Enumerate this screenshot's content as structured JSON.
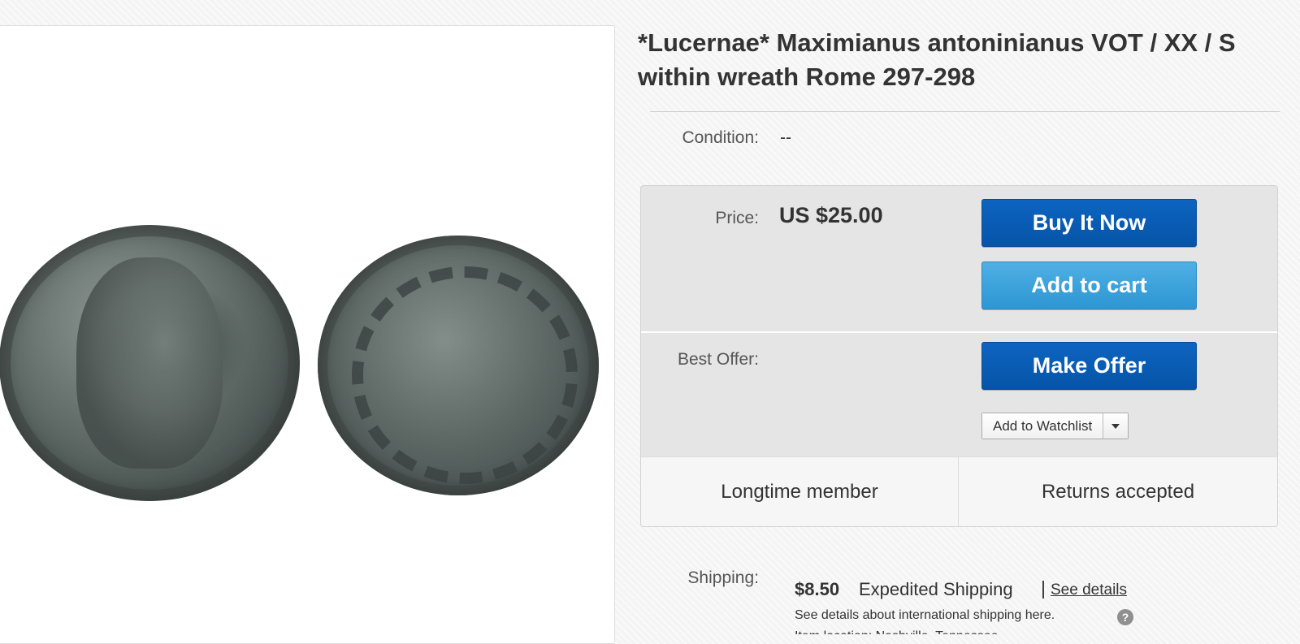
{
  "listing": {
    "title": "*Lucernae* Maximianus antoninianus VOT / XX / S within wreath Rome 297-298"
  },
  "condition": {
    "label": "Condition:",
    "value": "--"
  },
  "price": {
    "label": "Price:",
    "value": "US $25.00"
  },
  "buttons": {
    "buy_now": "Buy It Now",
    "add_to_cart": "Add to cart",
    "make_offer": "Make Offer",
    "watchlist": "Add to Watchlist"
  },
  "best_offer": {
    "label": "Best Offer:"
  },
  "badges": [
    "Longtime member",
    "Returns accepted"
  ],
  "shipping": {
    "label": "Shipping:",
    "price": "$8.50",
    "type": "Expedited Shipping",
    "separator": "|",
    "details_link": "See details",
    "international_note": "See details about international shipping here.",
    "help_icon_glyph": "?",
    "partial_line": "Item location: Nashville, Tennessee"
  },
  "icons": {
    "dropdown": "chevron-down-icon",
    "help": "question-circle-icon"
  },
  "colors": {
    "primary_button": "#0654a8",
    "secondary_button": "#2d96d3"
  }
}
